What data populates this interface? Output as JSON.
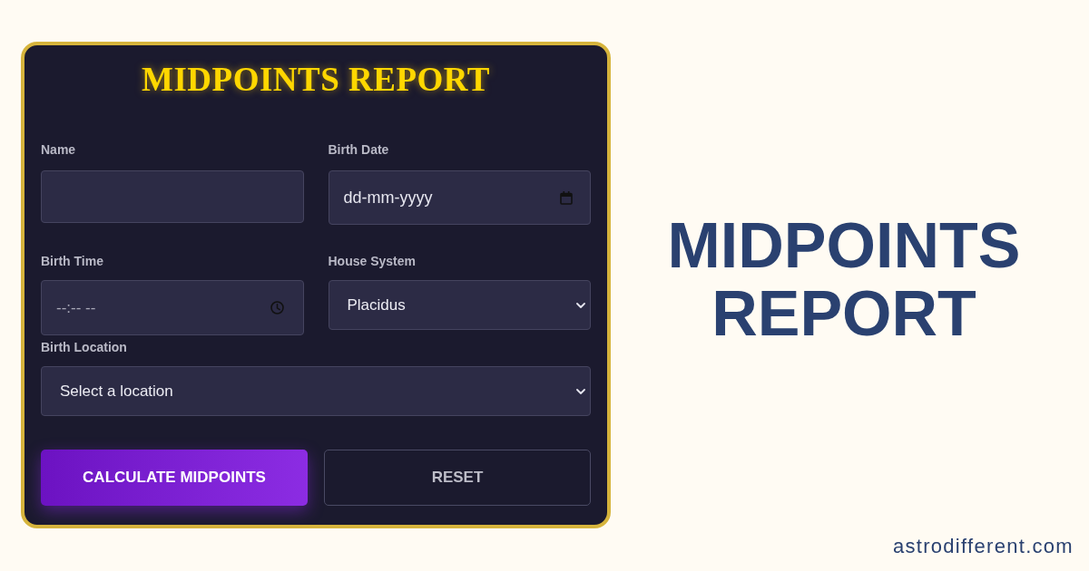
{
  "form": {
    "title": "MIDPOINTS REPORT",
    "rows": [
      [
        {
          "kind": "text",
          "label": "Name"
        },
        {
          "kind": "date",
          "label": "Birth Date",
          "placeholder": "dd-mm-yyyy"
        }
      ],
      [
        {
          "kind": "time",
          "label": "Birth Time",
          "placeholder": "--:-- --"
        },
        {
          "kind": "select",
          "label": "House System",
          "value": "Placidus"
        }
      ],
      [
        {
          "kind": "select",
          "label": "Birth Location",
          "value": "Select a location"
        }
      ]
    ],
    "buttons": [
      {
        "kind": "primary",
        "label": "CALCULATE MIDPOINTS"
      },
      {
        "kind": "secondary",
        "label": "RESET"
      }
    ]
  },
  "heading": "MIDPOINTS REPORT",
  "site_url": "astrodifferent.com"
}
